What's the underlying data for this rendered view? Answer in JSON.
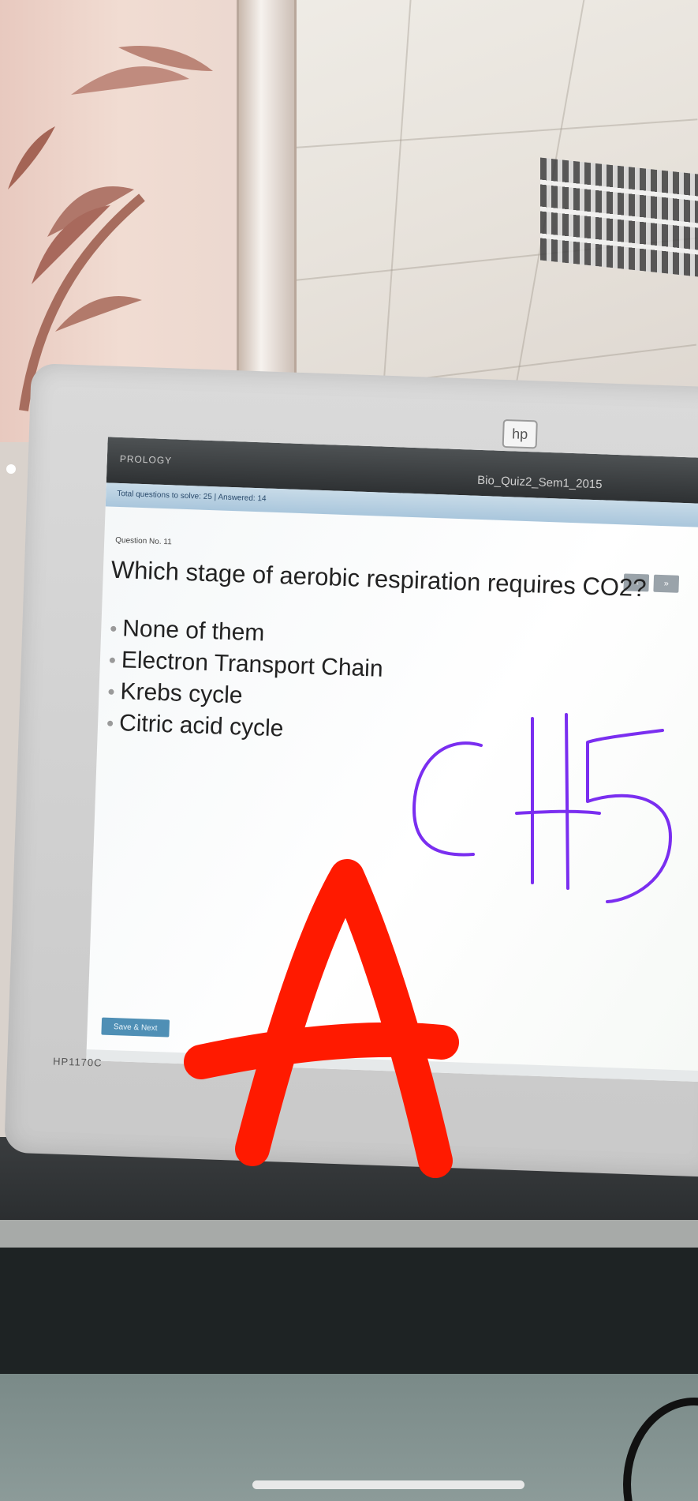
{
  "photo": {
    "subject": "Photo of a computer monitor showing an online quiz, with handwritten overlay marks",
    "monitor": {
      "brand_badge": "hp",
      "model_label": "HP1170C"
    },
    "screen": {
      "brand": "PROLOGY",
      "quiz_title": "Bio_Quiz2_Sem1_2015",
      "info_bar": "Total questions to solve: 25 | Answered: 14",
      "question_number": "Question No. 11",
      "nav_prev": "«",
      "nav_next": "»",
      "question": "Which stage of aerobic respiration requires CO2?",
      "options": [
        "None of them",
        "Electron Transport Chain",
        "Krebs cycle",
        "Citric acid cycle"
      ],
      "save_button": "Save & Next"
    },
    "annotations": {
      "handwritten_text": "CH5",
      "handwritten_answer": "A",
      "ink_colors": {
        "purple": "#7a2ef0",
        "red": "#ff1a00"
      }
    }
  }
}
